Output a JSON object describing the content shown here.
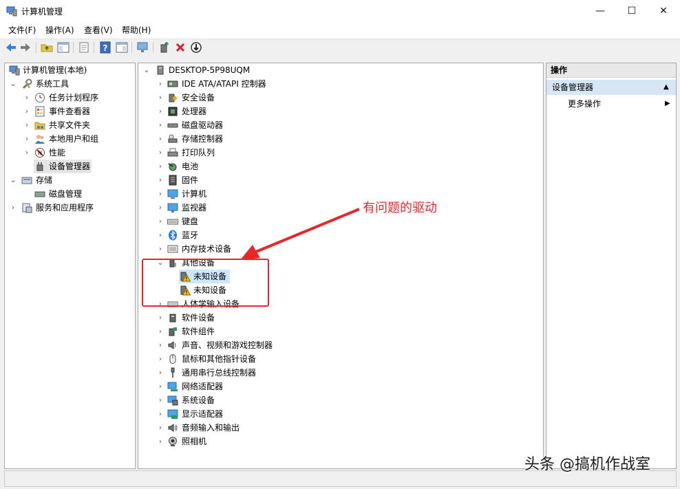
{
  "window": {
    "title": "计算机管理",
    "controls": {
      "minimize": "—",
      "maximize": "☐",
      "close": "✕"
    }
  },
  "menu": [
    "文件(F)",
    "操作(A)",
    "查看(V)",
    "帮助(H)"
  ],
  "toolbar": [
    "back-icon",
    "forward-icon",
    "up-folder-icon",
    "show-hide-tree-icon",
    "export-icon",
    "help-icon",
    "properties-icon",
    "monitor-icon",
    "update-driver-icon",
    "uninstall-icon",
    "scan-hardware-icon"
  ],
  "left_tree": {
    "root": "计算机管理(本地)",
    "system_tools": "系统工具",
    "system_tools_items": [
      "任务计划程序",
      "事件查看器",
      "共享文件夹",
      "本地用户和组",
      "性能",
      "设备管理器"
    ],
    "storage": "存储",
    "storage_items": [
      "磁盘管理"
    ],
    "services": "服务和应用程序"
  },
  "device_tree": {
    "computer": "DESKTOP-5P98UQM",
    "categories_before": [
      "IDE ATA/ATAPI 控制器",
      "安全设备",
      "处理器",
      "磁盘驱动器",
      "存储控制器",
      "打印队列",
      "电池",
      "固件",
      "计算机",
      "监视器",
      "键盘",
      "蓝牙",
      "内存技术设备"
    ],
    "other_devices": "其他设备",
    "other_devices_items": [
      "未知设备",
      "未知设备"
    ],
    "categories_after": [
      "人体学输入设备",
      "软件设备",
      "软件组件",
      "声音、视频和游戏控制器",
      "鼠标和其他指针设备",
      "通用串行总线控制器",
      "网络适配器",
      "系统设备",
      "显示适配器",
      "音频输入和输出",
      "照相机"
    ]
  },
  "actions": {
    "header": "操作",
    "section": "设备管理器",
    "more": "更多操作"
  },
  "annotation": {
    "text": "有问题的驱动",
    "color": "#e8262a"
  },
  "watermark": "头条 @搞机作战室"
}
